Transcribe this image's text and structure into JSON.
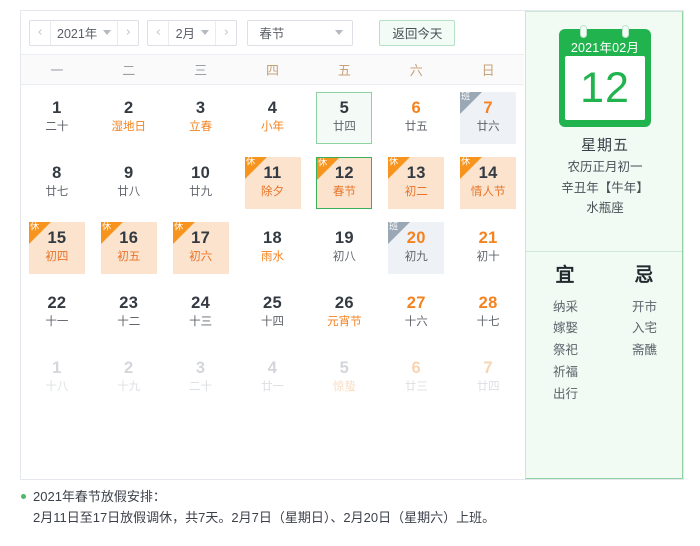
{
  "toolbar": {
    "year": "2021年",
    "month": "2月",
    "festival_select": "春节",
    "today_button": "返回今天",
    "prev_arrow": "‹",
    "next_arrow": "›"
  },
  "weekdays": [
    {
      "label": "一",
      "weekend": false
    },
    {
      "label": "二",
      "weekend": false
    },
    {
      "label": "三",
      "weekend": false
    },
    {
      "label": "四",
      "weekend": true
    },
    {
      "label": "五",
      "weekend": true
    },
    {
      "label": "六",
      "weekend": true
    },
    {
      "label": "日",
      "weekend": true
    }
  ],
  "badges": {
    "rest": "休",
    "work": "班"
  },
  "weeks": [
    [
      {
        "day": "1",
        "sub": "二十",
        "type": "normal"
      },
      {
        "day": "2",
        "sub": "湿地日",
        "type": "normal",
        "festival": true
      },
      {
        "day": "3",
        "sub": "立春",
        "type": "normal",
        "solar": true
      },
      {
        "day": "4",
        "sub": "小年",
        "type": "normal",
        "festival": true
      },
      {
        "day": "5",
        "sub": "廿四",
        "type": "normal",
        "selected": true
      },
      {
        "day": "6",
        "sub": "廿五",
        "type": "normal",
        "weekend": true
      },
      {
        "day": "7",
        "sub": "廿六",
        "type": "work",
        "weekend": true,
        "badge": "work"
      }
    ],
    [
      {
        "day": "8",
        "sub": "廿七",
        "type": "normal"
      },
      {
        "day": "9",
        "sub": "廿八",
        "type": "normal"
      },
      {
        "day": "10",
        "sub": "廿九",
        "type": "normal"
      },
      {
        "day": "11",
        "sub": "除夕",
        "type": "rest",
        "badge": "rest"
      },
      {
        "day": "12",
        "sub": "春节",
        "type": "rest",
        "badge": "rest",
        "today": true
      },
      {
        "day": "13",
        "sub": "初二",
        "type": "rest",
        "badge": "rest",
        "weekend": true
      },
      {
        "day": "14",
        "sub": "情人节",
        "type": "rest",
        "badge": "rest",
        "weekend": true
      }
    ],
    [
      {
        "day": "15",
        "sub": "初四",
        "type": "rest",
        "badge": "rest"
      },
      {
        "day": "16",
        "sub": "初五",
        "type": "rest",
        "badge": "rest"
      },
      {
        "day": "17",
        "sub": "初六",
        "type": "rest",
        "badge": "rest"
      },
      {
        "day": "18",
        "sub": "雨水",
        "type": "normal",
        "solar": true
      },
      {
        "day": "19",
        "sub": "初八",
        "type": "normal"
      },
      {
        "day": "20",
        "sub": "初九",
        "type": "work",
        "badge": "work",
        "weekend": true
      },
      {
        "day": "21",
        "sub": "初十",
        "type": "normal",
        "weekend": true
      }
    ],
    [
      {
        "day": "22",
        "sub": "十一",
        "type": "normal"
      },
      {
        "day": "23",
        "sub": "十二",
        "type": "normal"
      },
      {
        "day": "24",
        "sub": "十三",
        "type": "normal"
      },
      {
        "day": "25",
        "sub": "十四",
        "type": "normal"
      },
      {
        "day": "26",
        "sub": "元宵节",
        "type": "normal",
        "festival": true
      },
      {
        "day": "27",
        "sub": "十六",
        "type": "normal",
        "weekend": true
      },
      {
        "day": "28",
        "sub": "十七",
        "type": "normal",
        "weekend": true
      }
    ],
    [
      {
        "day": "1",
        "sub": "十八",
        "type": "other"
      },
      {
        "day": "2",
        "sub": "十九",
        "type": "other"
      },
      {
        "day": "3",
        "sub": "二十",
        "type": "other"
      },
      {
        "day": "4",
        "sub": "廿一",
        "type": "other"
      },
      {
        "day": "5",
        "sub": "惊蛰",
        "type": "other",
        "solar": true
      },
      {
        "day": "6",
        "sub": "廿三",
        "type": "other",
        "weekend": true
      },
      {
        "day": "7",
        "sub": "廿四",
        "type": "other",
        "weekend": true
      }
    ]
  ],
  "detail": {
    "header": "2021年02月",
    "day": "12",
    "weekday": "星期五",
    "lunar": "农历正月初一",
    "ganzhi": "辛丑年【牛年】",
    "zodiac": "水瓶座",
    "yi_title": "宜",
    "ji_title": "忌",
    "yi": [
      "纳采",
      "嫁娶",
      "祭祀",
      "祈福",
      "出行"
    ],
    "ji": [
      "开市",
      "入宅",
      "斋醮"
    ]
  },
  "footer": {
    "line1": "2021年春节放假安排：",
    "line2": "2月11日至17日放假调休，共7天。2月7日（星期日）、2月20日（星期六）上班。"
  },
  "colors": {
    "green": "#21b34e",
    "orange": "#f5821f",
    "rest_bg": "#fbe3cd",
    "work_bg": "#eef1f5",
    "side_bg": "#f1faf3"
  }
}
